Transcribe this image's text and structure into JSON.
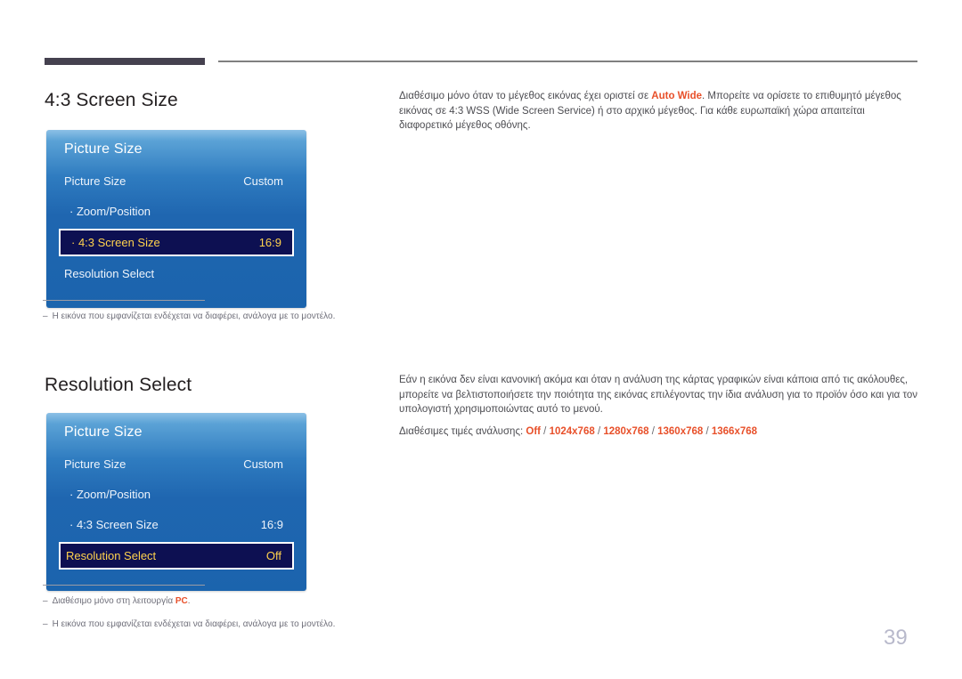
{
  "page": {
    "number": "39"
  },
  "sections": [
    {
      "heading": "4:3 Screen Size",
      "osd": {
        "title": "Picture Size",
        "rows": [
          {
            "label": "Picture Size",
            "value": "Custom",
            "selected": false,
            "indent": false
          },
          {
            "label": "· Zoom/Position",
            "value": "",
            "selected": false,
            "indent": true
          },
          {
            "label": "· 4:3 Screen Size",
            "value": "16:9",
            "selected": true,
            "indent": true
          },
          {
            "label": "Resolution Select",
            "value": "",
            "selected": false,
            "indent": false
          }
        ]
      },
      "body": {
        "para1_before": "Διαθέσιμο μόνο όταν το μέγεθος εικόνας έχει οριστεί σε ",
        "para1_highlight": "Auto Wide",
        "para1_after": ". Μπορείτε να ορίσετε το επιθυμητό μέγεθος εικόνας σε 4:3 WSS (Wide Screen Service) ή στο αρχικό μέγεθος. Για κάθε ευρωπαϊκή χώρα απαιτείται διαφορετικό μέγεθος οθόνης."
      },
      "footnotes": [
        {
          "dash": "–",
          "text": "Η εικόνα που εμφανίζεται ενδέχεται να διαφέρει, ανάλογα με το μοντέλο."
        }
      ]
    },
    {
      "heading": "Resolution Select",
      "osd": {
        "title": "Picture Size",
        "rows": [
          {
            "label": "Picture Size",
            "value": "Custom",
            "selected": false,
            "indent": false
          },
          {
            "label": "· Zoom/Position",
            "value": "",
            "selected": false,
            "indent": true
          },
          {
            "label": "· 4:3 Screen Size",
            "value": "16:9",
            "selected": false,
            "indent": true
          },
          {
            "label": "Resolution Select",
            "value": "Off",
            "selected": true,
            "indent": false
          }
        ]
      },
      "body": {
        "para1": "Εάν η εικόνα δεν είναι κανονική ακόμα και όταν η ανάλυση της κάρτας γραφικών είναι κάποια από τις ακόλουθες, μπορείτε να βελτιστοποιήσετε την ποιότητα της εικόνας επιλέγοντας την ίδια ανάλυση για το προϊόν όσο και για τον υπολογιστή χρησιμοποιώντας αυτό το μενού.",
        "para2_label": "Διαθέσιμες τιμές ανάλυσης: ",
        "para2_values": [
          "Off",
          "1024x768",
          "1280x768",
          "1360x768",
          "1366x768"
        ],
        "para2_separator": " / "
      },
      "footnotes": [
        {
          "dash": "–",
          "text_before": "Διαθέσιμο μόνο στη λειτουργία ",
          "highlight": "PC",
          "text_after": "."
        },
        {
          "dash": "–",
          "text": "Η εικόνα που εμφανίζεται ενδέχεται να διαφέρει, ανάλογα με το μοντέλο."
        }
      ]
    }
  ],
  "colors": {
    "accent_orange": "#e8502a",
    "osd_blue": "#1f66b0",
    "osd_selected_bg": "#0d1052",
    "osd_selected_text": "#ffd24d",
    "header_bar": "#45414f"
  }
}
